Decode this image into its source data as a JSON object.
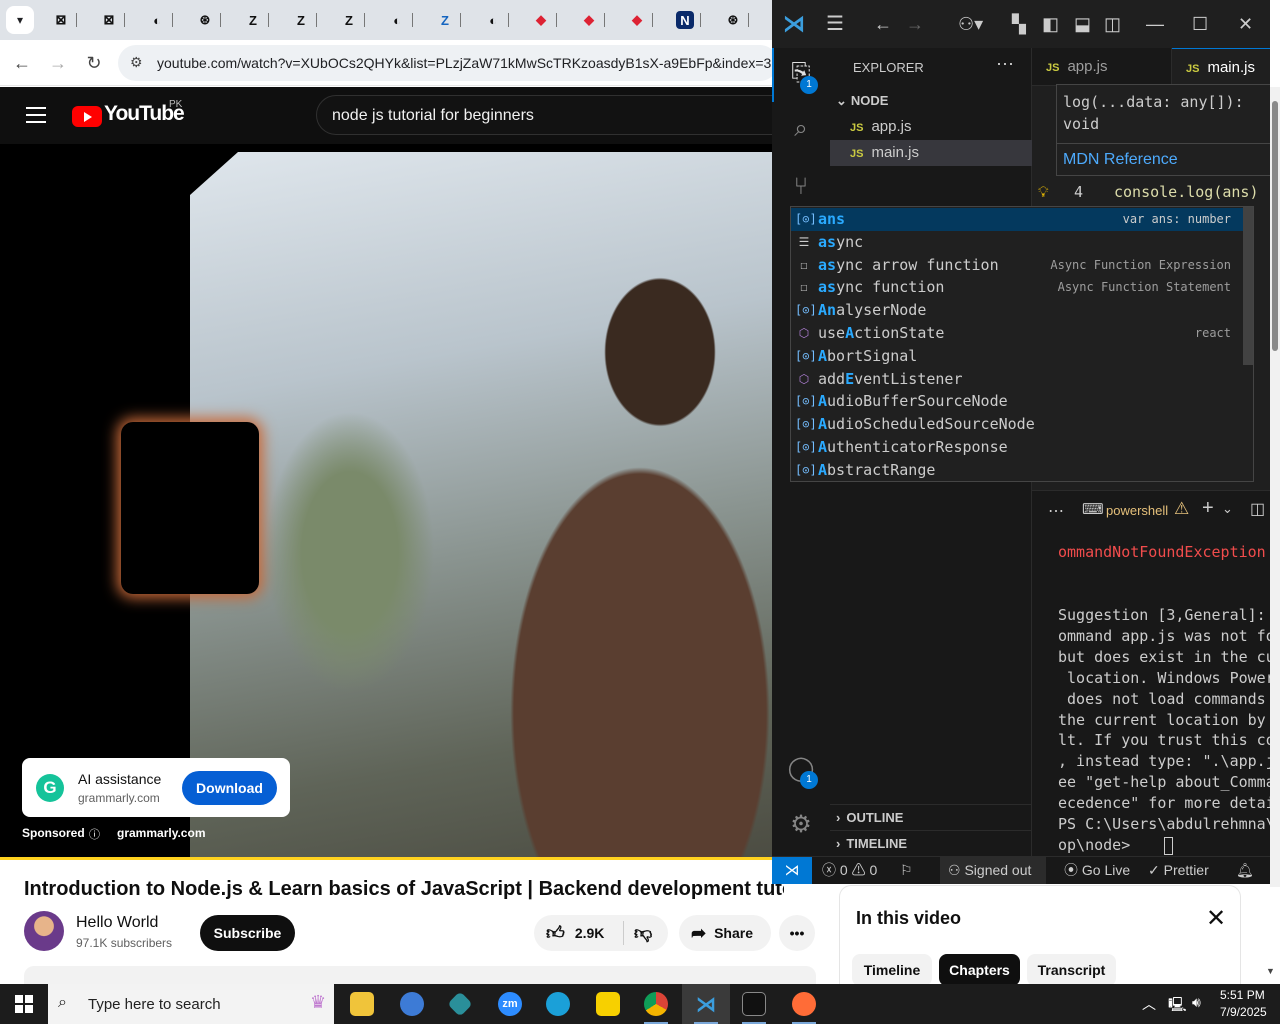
{
  "browser": {
    "tabs": [
      {
        "icon": "generic-tab-icon",
        "glyph": "⊠",
        "color": "#dfe3e8"
      },
      {
        "icon": "generic-tab-icon",
        "glyph": "⊠",
        "color": "#dfe3e8"
      },
      {
        "icon": "globe-icon",
        "glyph": "◐",
        "color": "#dfe3e8"
      },
      {
        "icon": "openai-icon",
        "glyph": "⊛",
        "color": "#dfe3e8"
      },
      {
        "icon": "z-icon",
        "glyph": "Z",
        "color": "#dfe3e8"
      },
      {
        "icon": "z-icon",
        "glyph": "Z",
        "color": "#dfe3e8"
      },
      {
        "icon": "z-icon",
        "glyph": "Z",
        "color": "#dfe3e8"
      },
      {
        "icon": "globe-icon",
        "glyph": "◐",
        "color": "#dfe3e8"
      },
      {
        "icon": "z-blue-icon",
        "glyph": "Z",
        "color": "#dfe3e8"
      },
      {
        "icon": "globe-icon",
        "glyph": "◐",
        "color": "#dfe3e8"
      },
      {
        "icon": "gem-icon",
        "glyph": "◆",
        "color": "#dfe3e8"
      },
      {
        "icon": "gem-icon",
        "glyph": "◆",
        "color": "#dfe3e8"
      },
      {
        "icon": "gem-icon",
        "glyph": "◆",
        "color": "#dfe3e8"
      },
      {
        "icon": "n-icon",
        "glyph": "N",
        "color": "#dfe3e8"
      },
      {
        "icon": "openai-icon",
        "glyph": "⊛",
        "color": "#dfe3e8"
      }
    ],
    "url": "youtube.com/watch?v=XUbOCs2QHYk&list=PLzjZaW71kMwScTRKzoasdyB1sX-a9EbFp&index=3"
  },
  "youtube": {
    "logo_text": "YouTube",
    "country": "PK",
    "search_value": "node js tutorial for beginners",
    "ad": {
      "title": "AI assistance",
      "domain": "grammarly.com",
      "logo_letter": "G",
      "button": "Download",
      "sponsored": "Sponsored",
      "sponsored_domain": "grammarly.com"
    },
    "video_title": "Introduction to Node.js & Learn basics of JavaScript | Backend development tutorial",
    "channel": {
      "name": "Hello World",
      "subscribers": "97.1K subscribers"
    },
    "subscribe": "Subscribe",
    "likes": "2.9K",
    "share": "Share",
    "chapters": {
      "title": "In this video",
      "tabs": [
        "Timeline",
        "Chapters",
        "Transcript"
      ],
      "selected": "Chapters"
    }
  },
  "vscode": {
    "explorer_title": "EXPLORER",
    "folder": "NODE",
    "files": [
      "app.js",
      "main.js"
    ],
    "selected_file": "main.js",
    "outline": "OUTLINE",
    "timeline": "TIMELINE",
    "js_badge": "JS",
    "badge_count": "1",
    "tabs": [
      "app.js",
      "main.js"
    ],
    "active_tab": "main.js",
    "hover": {
      "sig_1": "log(...data: any[]):",
      "sig_2": "void",
      "link": "MDN Reference"
    },
    "code": {
      "line_number": "4",
      "text": "console.log(ans)"
    },
    "suggestions": [
      {
        "icon": "variable-icon",
        "pre": "",
        "hl": "ans",
        "post": "",
        "detail": "var ans: number",
        "selected": true
      },
      {
        "icon": "keyword-icon",
        "pre": "",
        "hl": "as",
        "post": "ync",
        "detail": ""
      },
      {
        "icon": "snippet-icon",
        "pre": "",
        "hl": "as",
        "post": "ync arrow function",
        "detail": "Async Function Expression"
      },
      {
        "icon": "snippet-icon",
        "pre": "",
        "hl": "as",
        "post": "ync function",
        "detail": "Async Function Statement"
      },
      {
        "icon": "variable-icon",
        "pre": "",
        "hl": "An",
        "post": "alyserNode",
        "detail": ""
      },
      {
        "icon": "module-icon",
        "pre": "use",
        "hl": "A",
        "post": "ctionState",
        "detail": "react"
      },
      {
        "icon": "variable-icon",
        "pre": "",
        "hl": "A",
        "post": "bortSignal",
        "detail": ""
      },
      {
        "icon": "module-icon",
        "pre": "add",
        "hl": "E",
        "post": "ventListener",
        "detail": ""
      },
      {
        "icon": "variable-icon",
        "pre": "",
        "hl": "A",
        "post": "udioBufferSourceNode",
        "detail": ""
      },
      {
        "icon": "variable-icon",
        "pre": "",
        "hl": "A",
        "post": "udioScheduledSourceNode",
        "detail": ""
      },
      {
        "icon": "variable-icon",
        "pre": "",
        "hl": "A",
        "post": "uthenticatorResponse",
        "detail": ""
      },
      {
        "icon": "variable-icon",
        "pre": "",
        "hl": "A",
        "post": "bstractRange",
        "detail": ""
      }
    ],
    "terminal": {
      "shell": "powershell",
      "error_line": "ommandNotFoundException",
      "output": "Suggestion [3,General]:\nommand app.js was not fo\nbut does exist in the cu\n location. Windows Power\n does not load commands \nthe current location by \nlt. If you trust this co\n, instead type: \".\\app.j\nee \"get-help about_Comma\necedence\" for more detai\nPS C:\\Users\\abdulrehmna\\\nop\\node> "
    },
    "status": {
      "errors": "0",
      "warnings": "0",
      "account": "Signed out",
      "live": "Go Live",
      "prettier": "Prettier"
    }
  },
  "taskbar": {
    "search_placeholder": "Type here to search",
    "time": "5:51 PM",
    "date": "7/9/2025"
  },
  "colors": {
    "yt_red": "#ff0000",
    "vscode_accent": "#0078d4",
    "download_blue": "#065fd4"
  }
}
